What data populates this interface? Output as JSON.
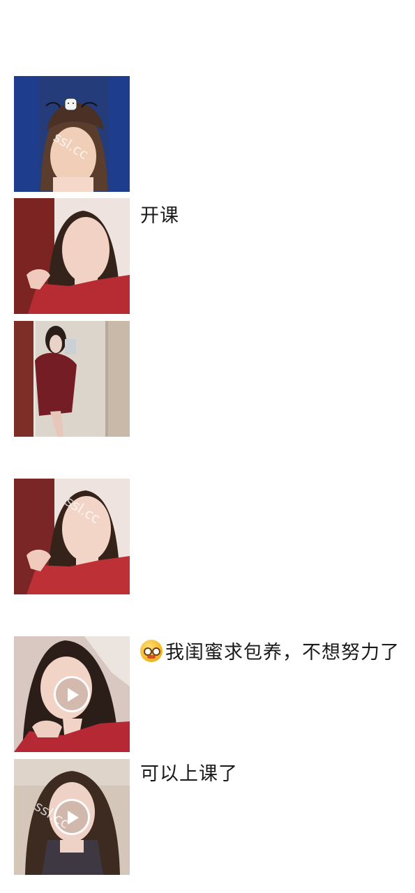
{
  "feed": {
    "posts": [
      {
        "kind": "photo",
        "caption": "",
        "overlay": "cat-doodle-sticker",
        "colors": {
          "background": "#243c7a",
          "hair": "#5b3d2e",
          "skin": "#f0ceb7"
        }
      },
      {
        "kind": "photo",
        "caption": "开课",
        "colors": {
          "background": "#7b2422",
          "hair": "#33231b",
          "skin": "#f2d2c4",
          "top": "#b72b33"
        }
      },
      {
        "kind": "photo",
        "caption": "",
        "colors": {
          "background": "#d7ccbd",
          "door": "#7d2f27",
          "top": "#741d25"
        }
      },
      {
        "kind": "photo",
        "caption": "",
        "colors": {
          "background": "#7a2526",
          "hair": "#352219",
          "skin": "#f3d5c8",
          "top": "#bd3036"
        }
      },
      {
        "kind": "video",
        "caption": "我闺蜜求包养，不想努力了",
        "emoji": "nerd-face-emoji",
        "colors": {
          "background": "#d8c8c1",
          "hair": "#2b1d18",
          "skin": "#f2d4c6",
          "top": "#b52834"
        }
      },
      {
        "kind": "video",
        "caption": "可以上课了",
        "colors": {
          "background": "#d4c6b9",
          "hair": "#3d2b22",
          "skin": "#eed2c5",
          "top": "#3e3843"
        }
      }
    ],
    "watermark_text": "ssl.cc"
  },
  "icons": {
    "play": "play-icon",
    "emoji": "nerd-face-emoji"
  }
}
